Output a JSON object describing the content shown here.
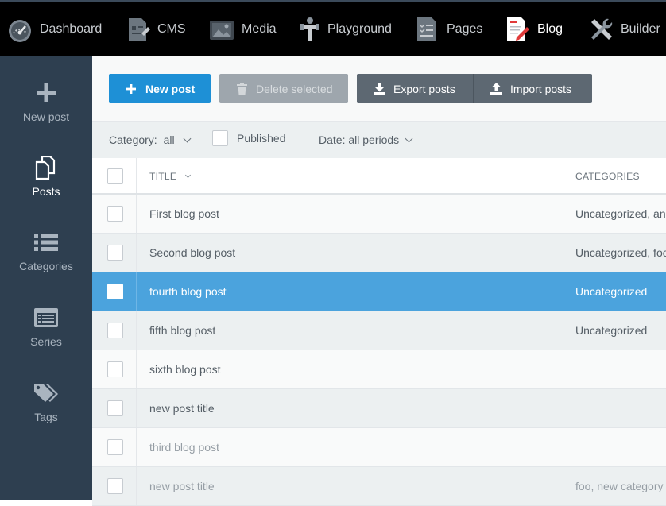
{
  "topnav": {
    "items": [
      {
        "label": "Dashboard",
        "icon": "dashboard-icon"
      },
      {
        "label": "CMS",
        "icon": "cms-icon"
      },
      {
        "label": "Media",
        "icon": "media-icon"
      },
      {
        "label": "Playground",
        "icon": "playground-icon"
      },
      {
        "label": "Pages",
        "icon": "pages-icon"
      },
      {
        "label": "Blog",
        "icon": "blog-icon",
        "active": true
      },
      {
        "label": "Builder",
        "icon": "builder-icon"
      }
    ]
  },
  "sidebar": {
    "items": [
      {
        "label": "New post",
        "icon": "plus-icon"
      },
      {
        "label": "Posts",
        "icon": "posts-icon",
        "active": true
      },
      {
        "label": "Categories",
        "icon": "list-icon"
      },
      {
        "label": "Series",
        "icon": "series-icon"
      },
      {
        "label": "Tags",
        "icon": "tags-icon"
      }
    ]
  },
  "toolbar": {
    "new_post": "New post",
    "delete_selected": "Delete selected",
    "export_posts": "Export posts",
    "import_posts": "Import posts"
  },
  "filters": {
    "category_label": "Category:",
    "category_value": "all",
    "published_label": "Published",
    "published_checked": false,
    "date_label": "Date: all periods"
  },
  "table": {
    "columns": [
      "TITLE",
      "CATEGORIES"
    ],
    "rows": [
      {
        "title": "First blog post",
        "categories": "Uncategorized, and",
        "state": "normal"
      },
      {
        "title": "Second blog post",
        "categories": "Uncategorized, foo",
        "state": "normal"
      },
      {
        "title": "fourth blog post",
        "categories": "Uncategorized",
        "state": "selected"
      },
      {
        "title": "fifth blog post",
        "categories": "Uncategorized",
        "state": "normal"
      },
      {
        "title": "sixth blog post",
        "categories": "",
        "state": "normal"
      },
      {
        "title": "new post title",
        "categories": "",
        "state": "normal"
      },
      {
        "title": "third blog post",
        "categories": "",
        "state": "draft"
      },
      {
        "title": "new post title",
        "categories": "foo, new category",
        "state": "draft"
      }
    ]
  },
  "colors": {
    "topbar": "#000000",
    "sidebar": "#2e3f50",
    "primary": "#1e90d6",
    "selected_row": "#4ba3dd"
  }
}
